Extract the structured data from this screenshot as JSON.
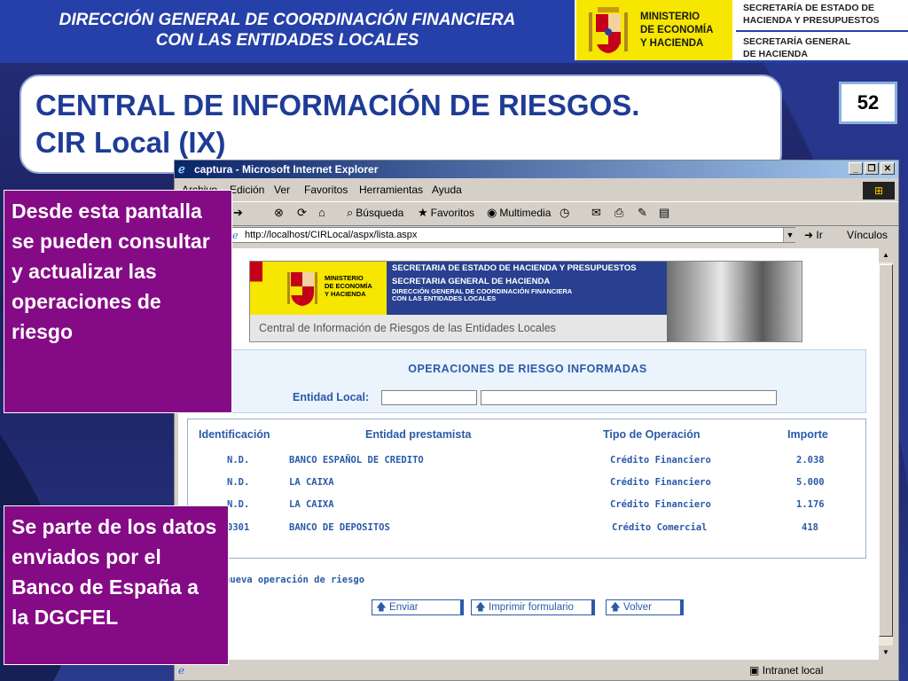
{
  "header": {
    "left_line1": "DIRECCIÓN GENERAL DE COORDINACIÓN FINANCIERA",
    "left_line2": "CON LAS ENTIDADES LOCALES",
    "ministry_1": "MINISTERIO",
    "ministry_2": "DE ECONOMÍA",
    "ministry_3": "Y HACIENDA",
    "right_1a": "SECRETARÍA DE ESTADO DE",
    "right_1b": "HACIENDA Y PRESUPUESTOS",
    "right_2a": "SECRETARÍA GENERAL",
    "right_2b": "DE HACIENDA"
  },
  "title": {
    "line1": "CENTRAL DE INFORMACIÓN DE RIESGOS.",
    "line2": "CIR Local (IX)"
  },
  "page_number": "52",
  "browser": {
    "title": "captura - Microsoft Internet Explorer",
    "menu": [
      "Archivo",
      "Edición",
      "Ver",
      "Favoritos",
      "Herramientas",
      "Ayuda"
    ],
    "toolbar": {
      "search": "Búsqueda",
      "favorites": "Favoritos",
      "multimedia": "Multimedia"
    },
    "address": "http://localhost/CIRLocal/aspx/lista.aspx",
    "go": "Ir",
    "links": "Vínculos",
    "status_zone": "Intranet local"
  },
  "banner": {
    "ministry_1": "MINISTERIO",
    "ministry_2": "DE ECONOMÍA",
    "ministry_3": "Y HACIENDA",
    "line1": "SECRETARIA DE ESTADO DE HACIENDA Y PRESUPUESTOS",
    "line2": "SECRETARIA GENERAL DE HACIENDA",
    "line3": "DIRECCIÓN GENERAL DE COORDINACIÓN FINANCIERA",
    "line4": "CON LAS ENTIDADES LOCALES",
    "bar": "Central de Información de Riesgos de las Entidades Locales"
  },
  "panel": {
    "title": "OPERACIONES DE RIESGO INFORMADAS",
    "entity_label": "Entidad Local:"
  },
  "table": {
    "headers": [
      "Identificación",
      "Entidad prestamista",
      "Tipo de Operación",
      "Importe"
    ],
    "rows": [
      [
        "N.D.",
        "BANCO ESPAÑOL DE CREDITO",
        "Crédito Financiero",
        "2.038"
      ],
      [
        "N.D.",
        "LA CAIXA",
        "Crédito Financiero",
        "5.000"
      ],
      [
        "N.D.",
        "LA CAIXA",
        "Crédito Financiero",
        "1.176"
      ],
      [
        "0301",
        "BANCO DE DEPOSITOS",
        "Crédito Comercial",
        "418"
      ]
    ]
  },
  "new_operation": "nueva operación de riesgo",
  "buttons": {
    "send": "Enviar",
    "print": "Imprimir formulario",
    "back": "Volver"
  },
  "callouts": {
    "top": "Desde esta pantalla se pueden consultar y actualizar las operaciones de riesgo",
    "bottom": "Se parte de los datos enviados por el Banco de España a la DGCFEL"
  }
}
